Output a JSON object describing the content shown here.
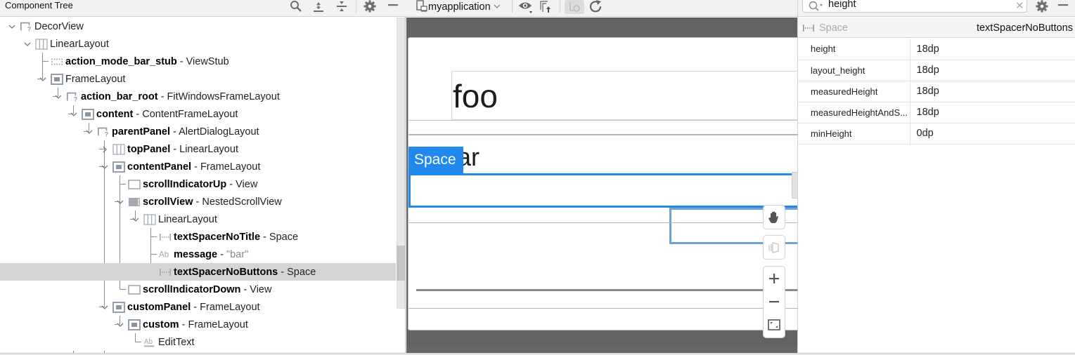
{
  "tree_panel": {
    "title": "Component Tree",
    "header_icons": [
      "search-icon",
      "expand-all-icon",
      "collapse-all-icon",
      "gear-icon",
      "minimize-icon"
    ]
  },
  "tree": [
    {
      "depth": 0,
      "expanded": true,
      "icon": "unknown-view-icon",
      "id": "",
      "type": "DecorView",
      "quote": "",
      "selected": false
    },
    {
      "depth": 1,
      "expanded": true,
      "icon": "linear-layout-icon",
      "id": "",
      "type": "LinearLayout",
      "quote": "",
      "selected": false
    },
    {
      "depth": 2,
      "expanded": null,
      "icon": "viewstub-icon",
      "id": "action_mode_bar_stub",
      "type": "ViewStub",
      "quote": "",
      "selected": false
    },
    {
      "depth": 2,
      "expanded": true,
      "icon": "frame-layout-icon",
      "id": "",
      "type": "FrameLayout",
      "quote": "",
      "selected": false
    },
    {
      "depth": 3,
      "expanded": true,
      "icon": "unknown-view-icon",
      "id": "action_bar_root",
      "type": "FitWindowsFrameLayout",
      "quote": "",
      "selected": false
    },
    {
      "depth": 4,
      "expanded": true,
      "icon": "frame-layout-icon",
      "id": "content",
      "type": "ContentFrameLayout",
      "quote": "",
      "selected": false
    },
    {
      "depth": 5,
      "expanded": true,
      "icon": "unknown-view-icon",
      "id": "parentPanel",
      "type": "AlertDialogLayout",
      "quote": "",
      "selected": false
    },
    {
      "depth": 6,
      "expanded": false,
      "icon": "linear-layout-icon",
      "id": "topPanel",
      "type": "LinearLayout",
      "quote": "",
      "selected": false
    },
    {
      "depth": 6,
      "expanded": true,
      "icon": "frame-layout-icon",
      "id": "contentPanel",
      "type": "FrameLayout",
      "quote": "",
      "selected": false
    },
    {
      "depth": 7,
      "expanded": null,
      "icon": "view-icon",
      "id": "scrollIndicatorUp",
      "type": "View",
      "quote": "",
      "selected": false
    },
    {
      "depth": 7,
      "expanded": true,
      "icon": "scrollview-icon",
      "id": "scrollView",
      "type": "NestedScrollView",
      "quote": "",
      "selected": false
    },
    {
      "depth": 8,
      "expanded": true,
      "icon": "linear-layout-icon",
      "id": "",
      "type": "LinearLayout",
      "quote": "",
      "selected": false
    },
    {
      "depth": 9,
      "expanded": null,
      "icon": "space-icon",
      "id": "textSpacerNoTitle",
      "type": "Space",
      "quote": "",
      "selected": false
    },
    {
      "depth": 9,
      "expanded": null,
      "icon": "textview-icon",
      "id": "message",
      "type": "",
      "quote": "\"bar\"",
      "selected": false
    },
    {
      "depth": 9,
      "expanded": null,
      "icon": "space-icon",
      "id": "textSpacerNoButtons",
      "type": "Space",
      "quote": "",
      "selected": true
    },
    {
      "depth": 7,
      "expanded": null,
      "icon": "view-icon",
      "id": "scrollIndicatorDown",
      "type": "View",
      "quote": "",
      "selected": false
    },
    {
      "depth": 6,
      "expanded": true,
      "icon": "frame-layout-icon",
      "id": "customPanel",
      "type": "FrameLayout",
      "quote": "",
      "selected": false
    },
    {
      "depth": 7,
      "expanded": true,
      "icon": "frame-layout-icon",
      "id": "custom",
      "type": "FrameLayout",
      "quote": "",
      "selected": false
    },
    {
      "depth": 8,
      "expanded": null,
      "icon": "edittext-icon",
      "id": "",
      "type": "EditText",
      "quote": "",
      "selected": false
    }
  ],
  "design": {
    "device": "myapplication",
    "toolbar_icons": [
      "device-icon",
      "eye-icon",
      "export-icon",
      "live-update-icon",
      "refresh-icon"
    ],
    "dialog_title": "foo",
    "dialog_message": "bar",
    "selection_label": "Space",
    "float_controls": [
      "pan-hand-icon",
      "layer-3d-icon",
      "zoom-in-icon",
      "zoom-out-icon",
      "fit-screen-icon"
    ]
  },
  "attributes": {
    "search_value": "height",
    "search_placeholder": "",
    "component_type": "Space",
    "component_id": "textSpacerNoButtons",
    "rows": [
      {
        "name": "height",
        "value": "18dp"
      },
      {
        "name": "layout_height",
        "value": "18dp"
      },
      {
        "name": "measuredHeight",
        "value": "18dp"
      },
      {
        "name": "measuredHeightAndS...",
        "value": "18dp"
      },
      {
        "name": "minHeight",
        "value": "0dp"
      }
    ]
  }
}
